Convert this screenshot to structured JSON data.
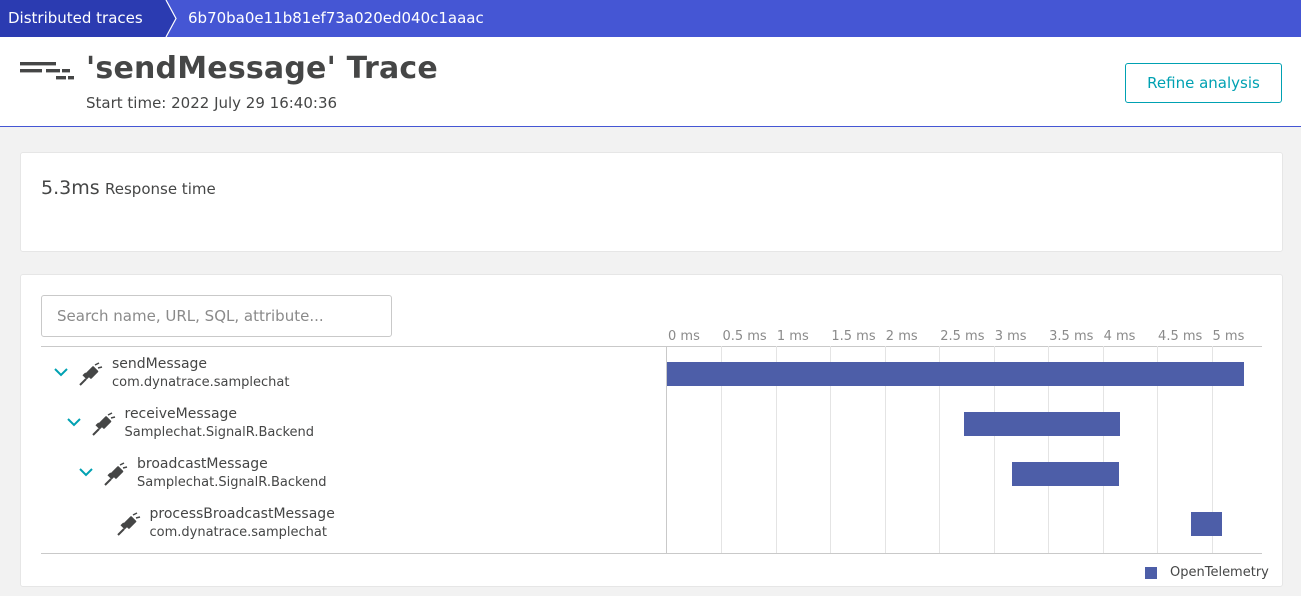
{
  "breadcrumb": {
    "items": [
      "Distributed traces",
      "6b70ba0e11b81ef73a020ed040c1aaac"
    ]
  },
  "header": {
    "title": "'sendMessage' Trace",
    "start_time": "Start time: 2022 July 29 16:40:36",
    "refine_label": "Refine analysis"
  },
  "summary": {
    "response_time_value": "5.3ms",
    "response_time_label": "Response time"
  },
  "search": {
    "placeholder": "Search name, URL, SQL, attribute..."
  },
  "timeline": {
    "unit": "ms",
    "max_ms": 5.3,
    "ticks": [
      "0 ms",
      "0.5 ms",
      "1 ms",
      "1.5 ms",
      "2 ms",
      "2.5 ms",
      "3 ms",
      "3.5 ms",
      "4 ms",
      "4.5 ms",
      "5 ms"
    ]
  },
  "spans": [
    {
      "name": "sendMessage",
      "service": "com.dynatrace.samplechat",
      "depth": 0,
      "expandable": true,
      "start_ms": 0.0,
      "end_ms": 5.3
    },
    {
      "name": "receiveMessage",
      "service": "Samplechat.SignalR.Backend",
      "depth": 1,
      "expandable": true,
      "start_ms": 2.73,
      "end_ms": 4.16
    },
    {
      "name": "broadcastMessage",
      "service": "Samplechat.SignalR.Backend",
      "depth": 2,
      "expandable": true,
      "start_ms": 3.17,
      "end_ms": 4.15
    },
    {
      "name": "processBroadcastMessage",
      "service": "com.dynatrace.samplechat",
      "depth": 3,
      "expandable": false,
      "start_ms": 4.81,
      "end_ms": 5.1
    }
  ],
  "legend": {
    "label": "OpenTelemetry",
    "color": "#4d5ea8"
  },
  "colors": {
    "breadcrumb_bg": "#4556d4",
    "breadcrumb_active_bg": "#2b3bb1",
    "accent": "#00a1b2",
    "bar": "#4d5ea8"
  }
}
